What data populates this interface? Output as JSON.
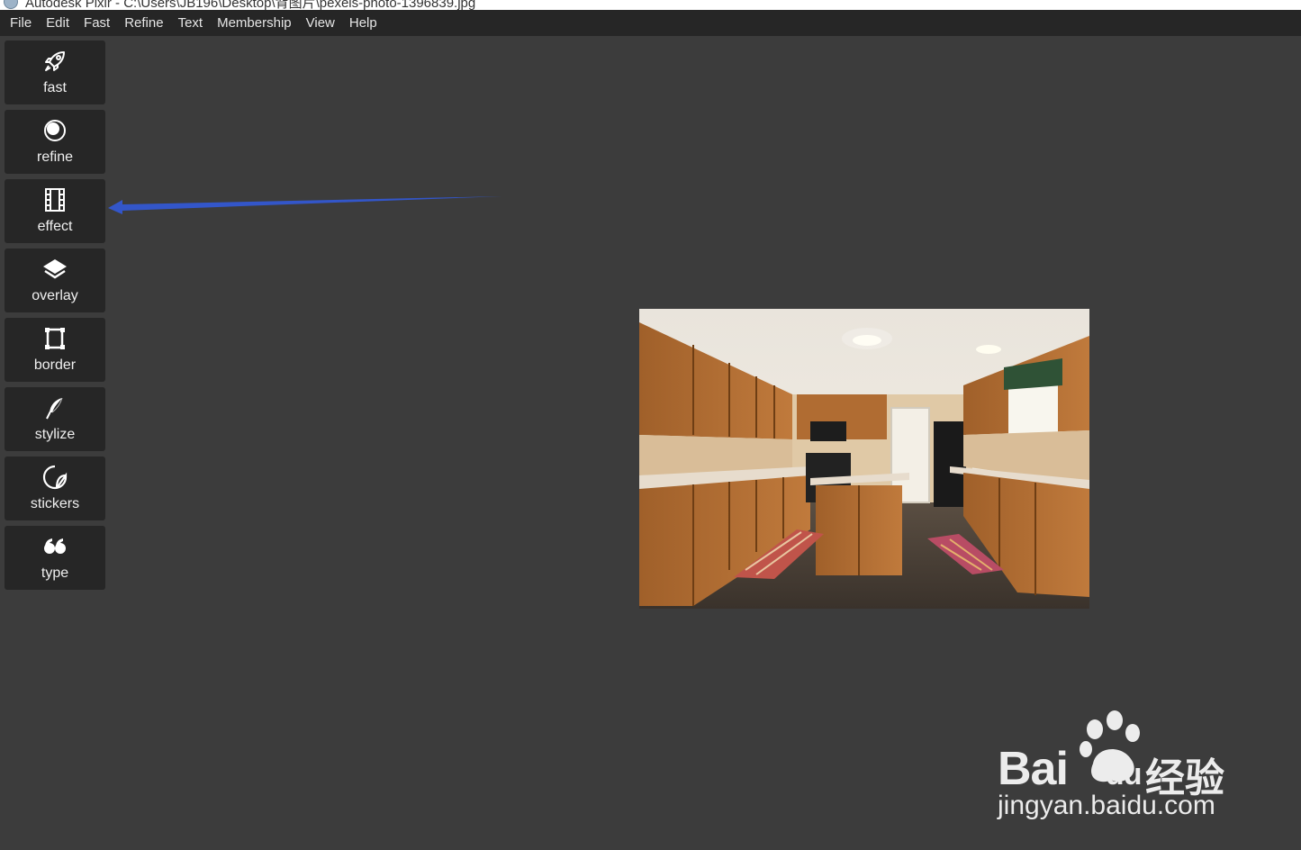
{
  "window": {
    "title": "Autodesk Pixlr - C:\\Users\\JB196\\Desktop\\背图片\\pexels-photo-1396839.jpg"
  },
  "menu": {
    "items": [
      "File",
      "Edit",
      "Fast",
      "Refine",
      "Text",
      "Membership",
      "View",
      "Help"
    ]
  },
  "toolbar": {
    "tools": [
      {
        "label": "fast",
        "icon": "rocket-icon"
      },
      {
        "label": "refine",
        "icon": "refine-icon"
      },
      {
        "label": "effect",
        "icon": "film-icon"
      },
      {
        "label": "overlay",
        "icon": "layers-icon"
      },
      {
        "label": "border",
        "icon": "frame-icon"
      },
      {
        "label": "stylize",
        "icon": "feather-icon"
      },
      {
        "label": "stickers",
        "icon": "sticker-icon"
      },
      {
        "label": "type",
        "icon": "quote-icon"
      }
    ]
  },
  "annotation": {
    "arrow_color": "#3356c9"
  },
  "canvas": {
    "image_alt": "kitchen photo"
  },
  "watermark": {
    "logo": "Bai",
    "logo_suffix": "du",
    "cn": "经验",
    "url": "jingyan.baidu.com"
  }
}
